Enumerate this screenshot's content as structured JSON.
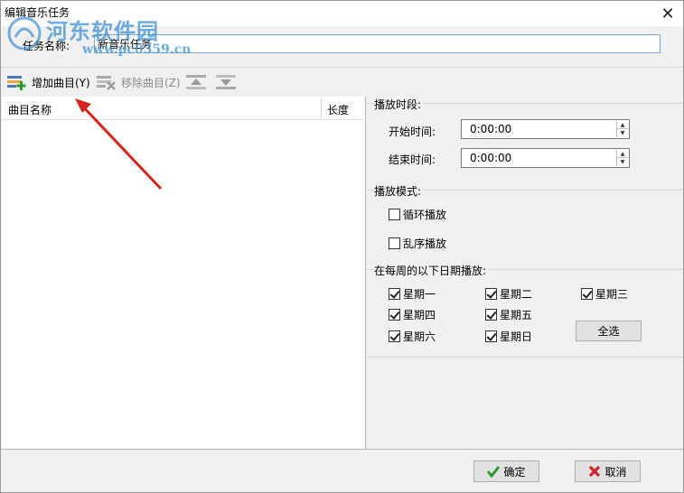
{
  "window": {
    "title": "编辑音乐任务",
    "close_glyph": "✕"
  },
  "watermark": {
    "name": "河东软件园",
    "site": "www.pc0359.cn"
  },
  "task": {
    "label": "任务名称:",
    "value": "新音乐任务"
  },
  "toolbar": {
    "add_label": "增加曲目(Y)",
    "remove_label": "移除曲目(Z)"
  },
  "list": {
    "columns": [
      "曲目名称",
      "长度"
    ]
  },
  "period": {
    "title": "播放时段:",
    "start_label": "开始时间:",
    "start_value": "0:00:00",
    "end_label": "结束时间:",
    "end_value": "0:00:00"
  },
  "mode": {
    "title": "播放模式:",
    "loop_label": "循环播放",
    "loop_checked": false,
    "shuffle_label": "乱序播放",
    "shuffle_checked": false
  },
  "weekdays": {
    "title": "在每周的以下日期播放:",
    "days": [
      {
        "label": "星期一",
        "checked": true
      },
      {
        "label": "星期二",
        "checked": true
      },
      {
        "label": "星期三",
        "checked": true
      },
      {
        "label": "星期四",
        "checked": true
      },
      {
        "label": "星期五",
        "checked": true
      },
      {
        "label": "星期六",
        "checked": true
      },
      {
        "label": "星期日",
        "checked": true
      }
    ],
    "select_all_label": "全选"
  },
  "footer": {
    "ok_label": "确定",
    "cancel_label": "取消"
  },
  "colors": {
    "annotation_arrow": "#d9261c",
    "watermark": "#3d8fd6",
    "input_border": "#7aa6d8"
  }
}
